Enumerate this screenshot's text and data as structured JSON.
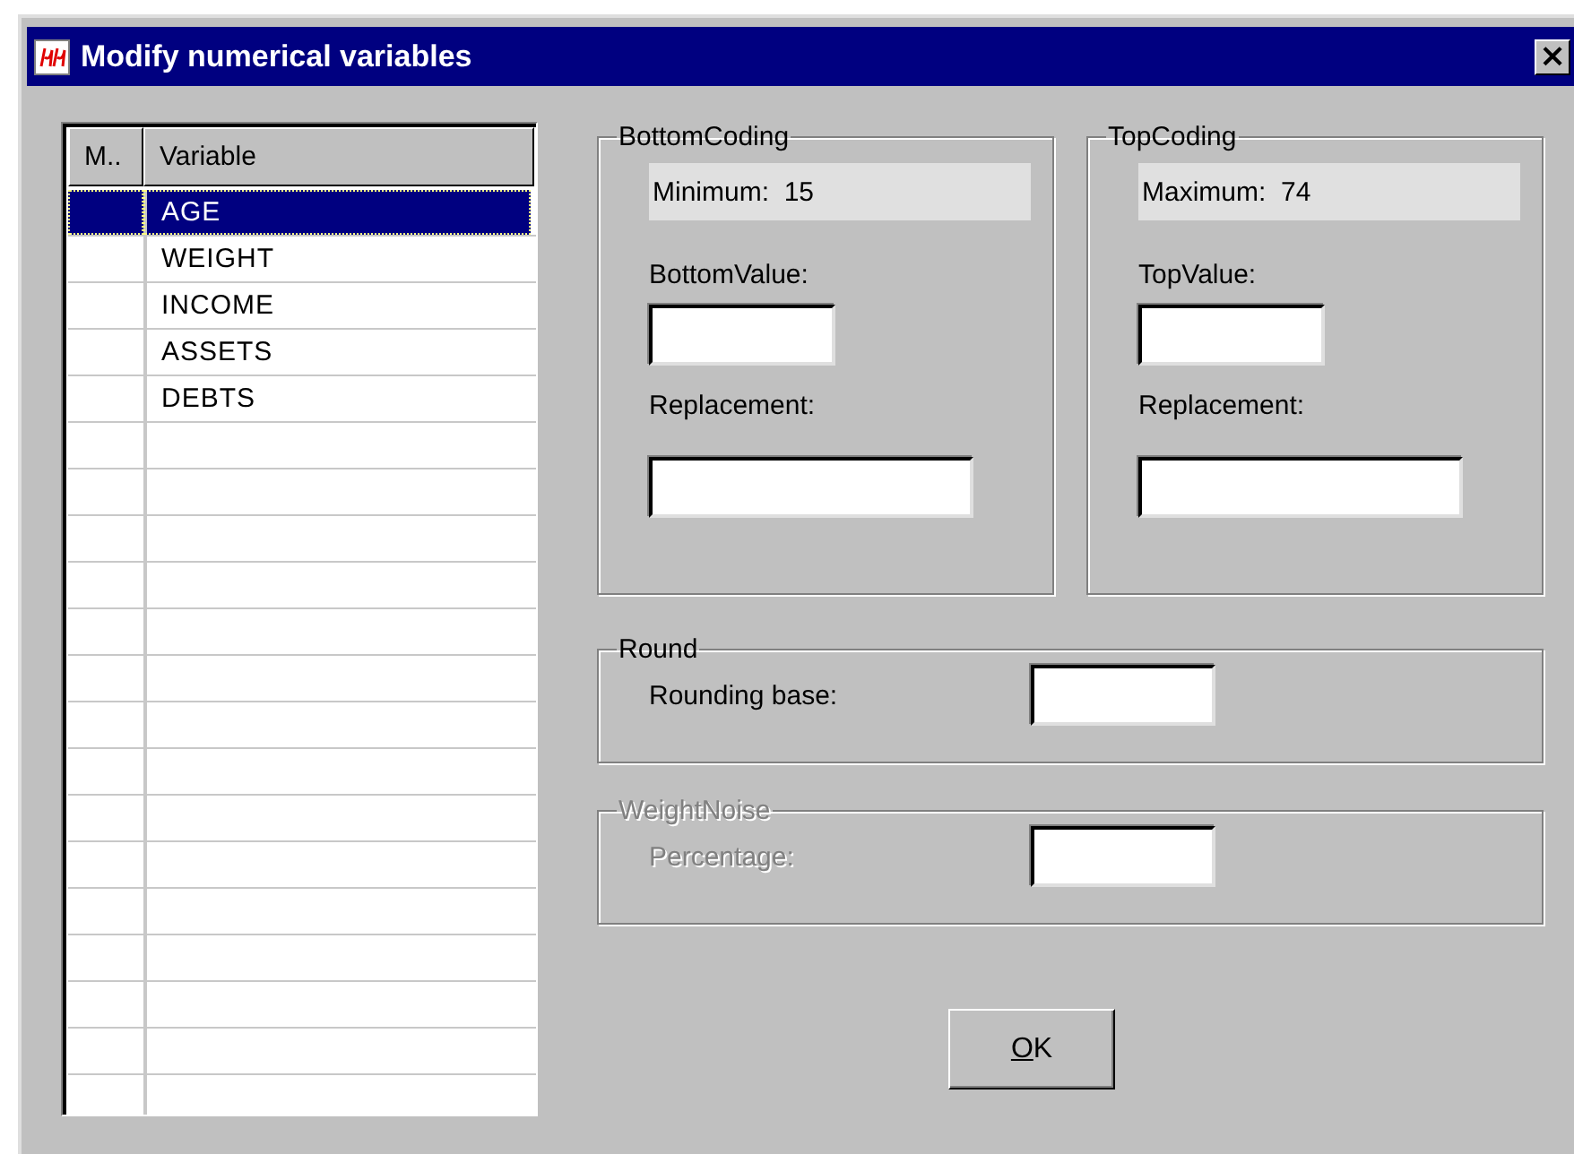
{
  "window": {
    "title": "Modify numerical variables",
    "close": "×"
  },
  "table": {
    "columns": [
      "M..",
      "Variable"
    ],
    "rows": [
      {
        "variable": "AGE",
        "selected": true
      },
      {
        "variable": "WEIGHT",
        "selected": false
      },
      {
        "variable": "INCOME",
        "selected": false
      },
      {
        "variable": "ASSETS",
        "selected": false
      },
      {
        "variable": "DEBTS",
        "selected": false
      }
    ]
  },
  "bottom_coding": {
    "title": "BottomCoding",
    "info": "Minimum:  15",
    "value_label": "BottomValue:",
    "replacement_label": "Replacement:"
  },
  "top_coding": {
    "title": "TopCoding",
    "info": "Maximum:  74",
    "value_label": "TopValue:",
    "replacement_label": "Replacement:"
  },
  "round": {
    "title": "Round",
    "label": "Rounding base:",
    "disabled": false
  },
  "weight_noise": {
    "title": "WeightNoise",
    "label": "Percentage:",
    "disabled": true
  },
  "ok_button": {
    "label": "OK",
    "mnemonic_underlined": true
  }
}
